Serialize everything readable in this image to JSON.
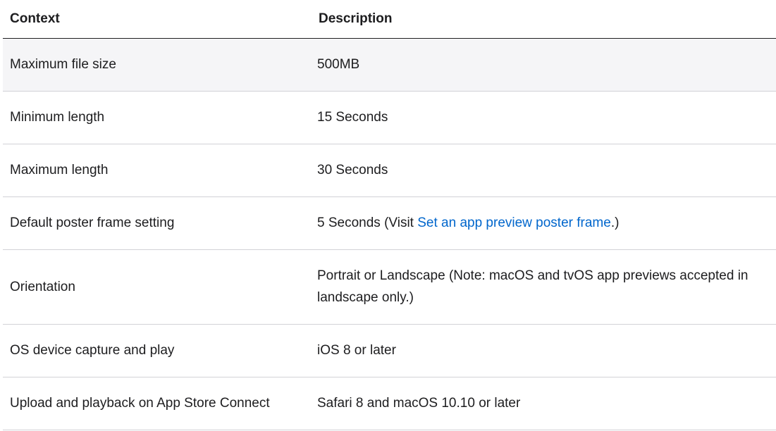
{
  "table": {
    "headers": [
      "Context",
      "Description"
    ],
    "rows": [
      {
        "context": "Maximum file size",
        "description": "500MB"
      },
      {
        "context": "Minimum length",
        "description": "15 Seconds"
      },
      {
        "context": "Maximum length",
        "description": "30 Seconds"
      },
      {
        "context": "Default poster frame setting",
        "description_prefix": "5 Seconds (Visit ",
        "description_link": "Set an app preview poster frame",
        "description_suffix": ".)"
      },
      {
        "context": "Orientation",
        "description": "Portrait or Landscape (Note: macOS and tvOS app previews accepted in landscape only.)"
      },
      {
        "context": "OS device capture and play",
        "description": "iOS 8 or later"
      },
      {
        "context": "Upload and playback on App Store Connect",
        "description": "Safari 8 and macOS 10.10 or later"
      }
    ]
  },
  "colors": {
    "text": "#1d1d1f",
    "link": "#0066cc",
    "row_alt_background": "#f5f5f7",
    "row_divider": "#d2d2d7"
  }
}
